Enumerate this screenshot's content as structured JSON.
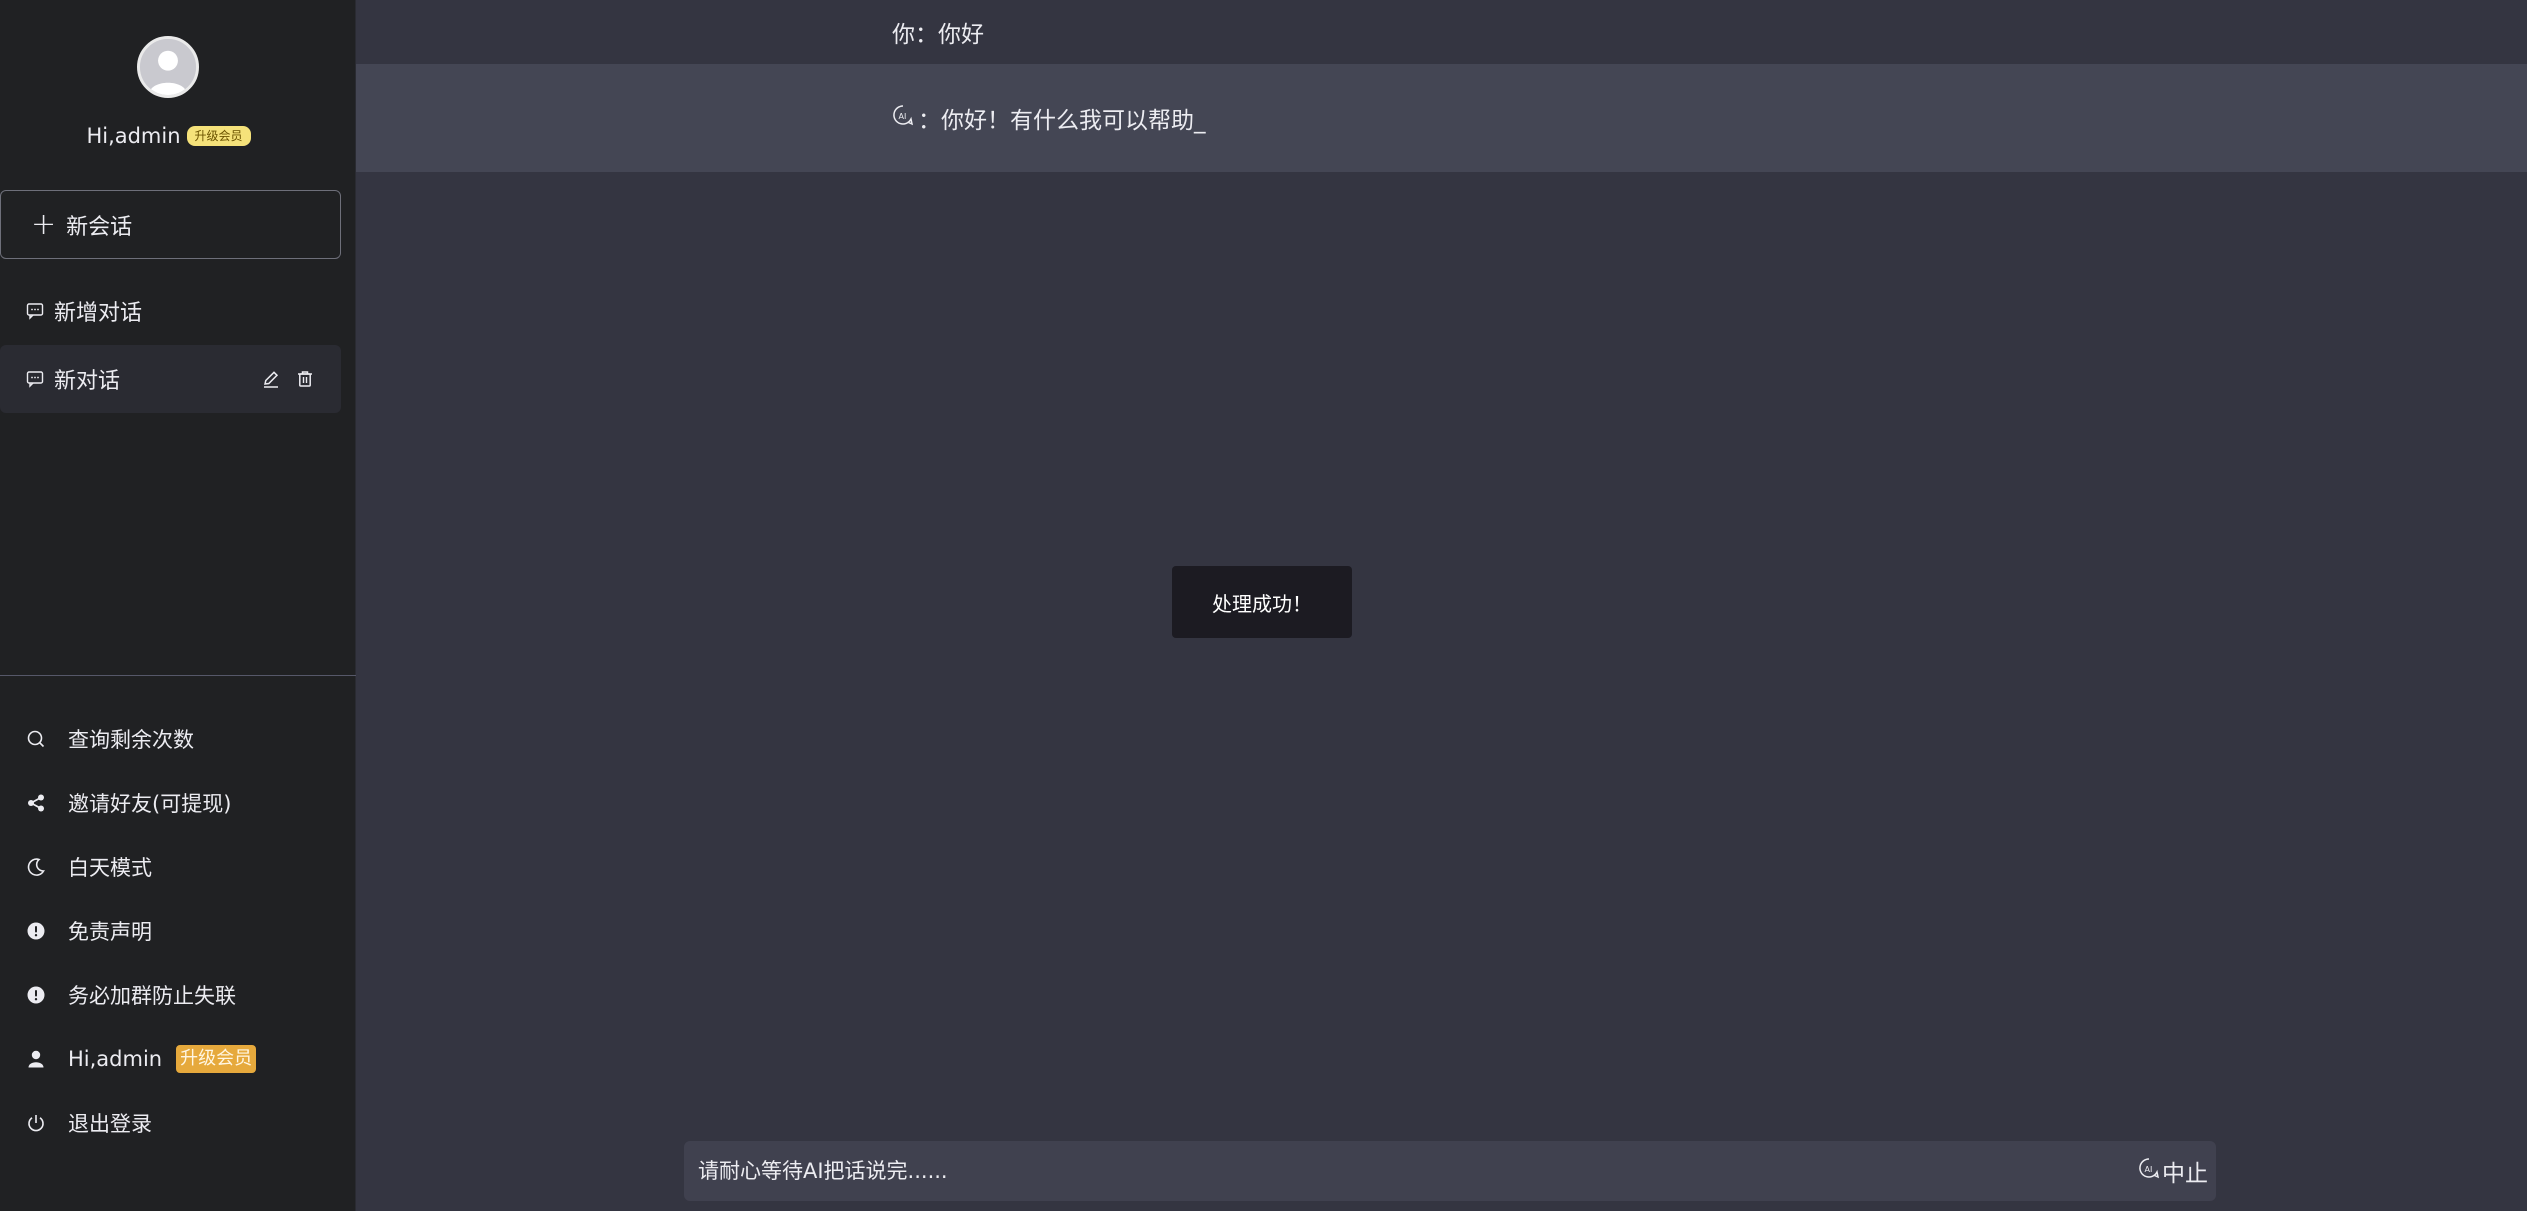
{
  "sidebar": {
    "user": {
      "greeting": "Hi,admin",
      "badge": "升级会员"
    },
    "new_chat_label": "新会话",
    "conversations": [
      {
        "label": "新增对话"
      },
      {
        "label": "新对话"
      }
    ],
    "menu": [
      {
        "label": "查询剩余次数",
        "icon": "search-icon"
      },
      {
        "label": "邀请好友(可提现)",
        "icon": "share-icon"
      },
      {
        "label": "白天模式",
        "icon": "moon-icon"
      },
      {
        "label": "免责声明",
        "icon": "alert-icon"
      },
      {
        "label": "务必加群防止失联",
        "icon": "alert-icon"
      },
      {
        "label": "Hi,admin",
        "icon": "user-icon",
        "badge": "升级会员"
      },
      {
        "label": "退出登录",
        "icon": "power-icon"
      }
    ]
  },
  "chat": {
    "user_message": "你：你好",
    "ai_message": "：你好！有什么我可以帮助_"
  },
  "toast": {
    "text": "处理成功！"
  },
  "input": {
    "placeholder": "请耐心等待AI把话说完......",
    "stop_label": "中止"
  },
  "colors": {
    "sidebar_bg": "#202123",
    "main_bg": "#343541",
    "ai_row_bg": "#444654",
    "input_bg": "#40414f",
    "vip_badge": "#e6a93c"
  }
}
